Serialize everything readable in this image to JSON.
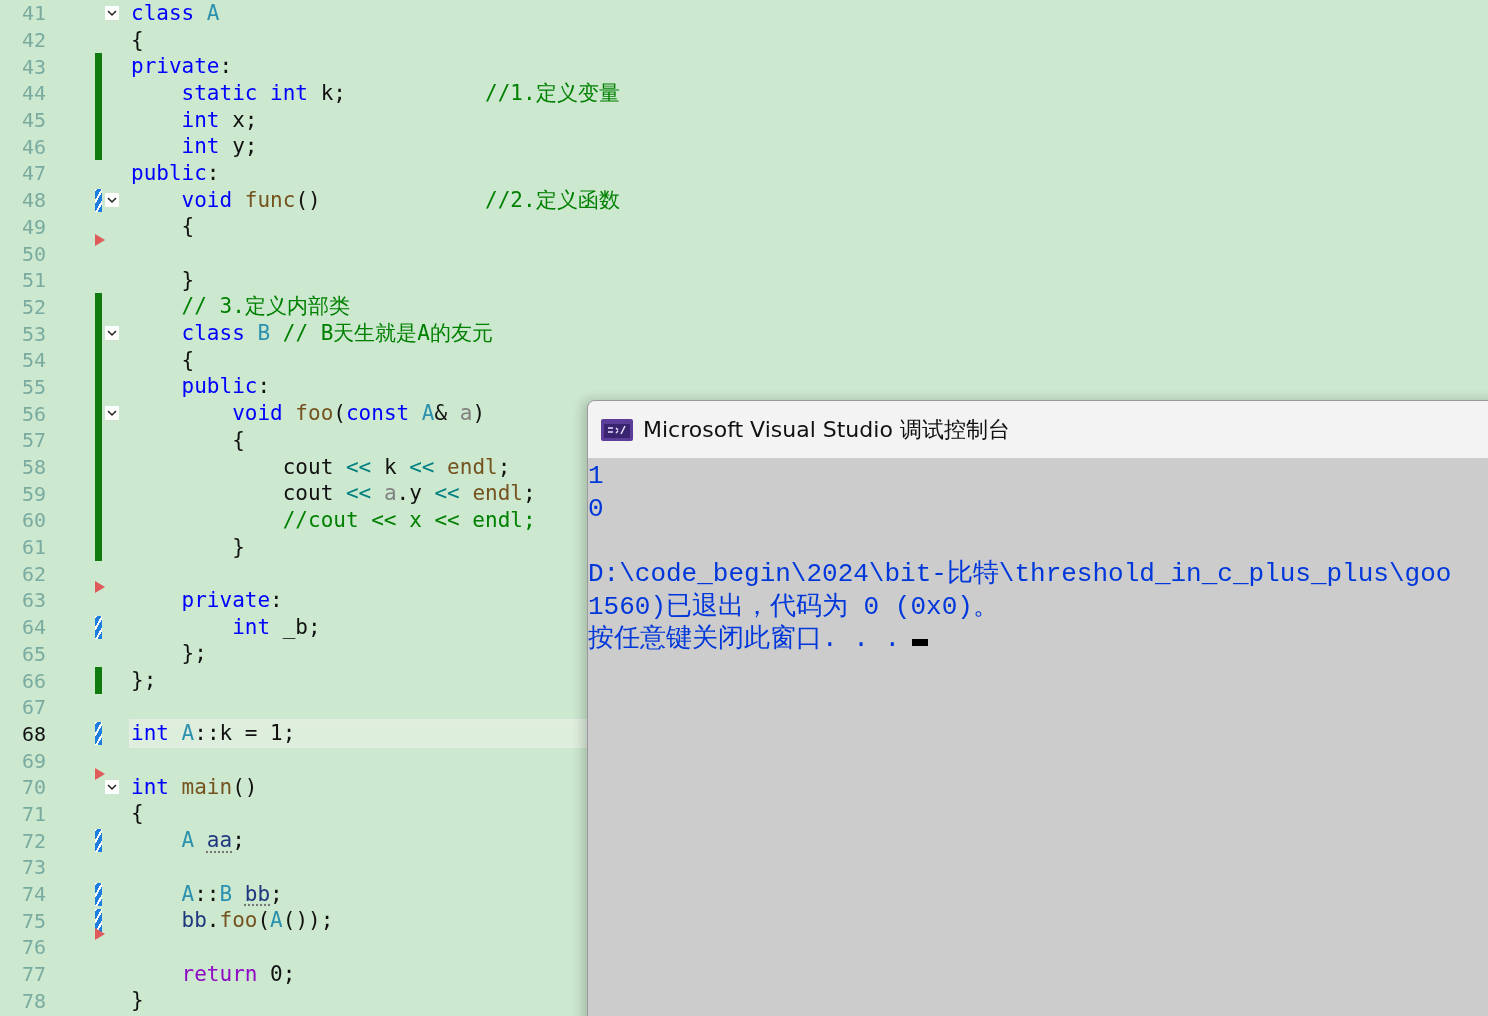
{
  "editor": {
    "lines": [
      {
        "number": "41",
        "fold_toggle": true,
        "tokens": [
          {
            "kind": "keyword",
            "text": "class"
          },
          {
            "kind": "type",
            "text": " A"
          }
        ]
      },
      {
        "number": "42",
        "tokens": [
          {
            "kind": "plain",
            "text": "{"
          }
        ]
      },
      {
        "number": "43",
        "saved": true,
        "tokens": [
          {
            "kind": "keyword",
            "text": "private"
          },
          {
            "kind": "plain",
            "text": ":"
          }
        ]
      },
      {
        "number": "44",
        "saved": true,
        "tokens": [
          {
            "kind": "keyword",
            "text": "    static int"
          },
          {
            "kind": "plain",
            "text": " k;"
          },
          {
            "kind": "comment",
            "text": "           //1.定义变量"
          }
        ]
      },
      {
        "number": "45",
        "saved": true,
        "tokens": [
          {
            "kind": "keyword",
            "text": "    int"
          },
          {
            "kind": "plain",
            "text": " x;"
          }
        ]
      },
      {
        "number": "46",
        "saved": true,
        "tokens": [
          {
            "kind": "keyword",
            "text": "    int"
          },
          {
            "kind": "plain",
            "text": " y;"
          }
        ]
      },
      {
        "number": "47",
        "tokens": [
          {
            "kind": "keyword",
            "text": "public"
          },
          {
            "kind": "plain",
            "text": ":"
          }
        ]
      },
      {
        "number": "48",
        "saved": false,
        "fold_toggle": true,
        "tokens": [
          {
            "kind": "keyword",
            "text": "    void"
          },
          {
            "kind": "function",
            "text": " func"
          },
          {
            "kind": "plain",
            "text": "()"
          },
          {
            "kind": "comment",
            "text": "             //2.定义函数"
          }
        ]
      },
      {
        "number": "49",
        "tokens": [
          {
            "kind": "plain",
            "text": "    {"
          }
        ]
      },
      {
        "number": "50",
        "hint_arrow": true
      },
      {
        "number": "51",
        "tokens": [
          {
            "kind": "plain",
            "text": "    }"
          }
        ]
      },
      {
        "number": "52",
        "saved": true,
        "tokens": [
          {
            "kind": "comment",
            "text": "    // 3.定义内部类"
          }
        ]
      },
      {
        "number": "53",
        "saved": true,
        "fold_toggle": true,
        "tokens": [
          {
            "kind": "keyword",
            "text": "    class"
          },
          {
            "kind": "type",
            "text": " B"
          },
          {
            "kind": "comment",
            "text": " // B天生就是A的友元"
          }
        ]
      },
      {
        "number": "54",
        "saved": true,
        "tokens": [
          {
            "kind": "plain",
            "text": "    {"
          }
        ]
      },
      {
        "number": "55",
        "saved": true,
        "tokens": [
          {
            "kind": "keyword",
            "text": "    public"
          },
          {
            "kind": "plain",
            "text": ":"
          }
        ]
      },
      {
        "number": "56",
        "saved": true,
        "fold_toggle": true,
        "tokens": [
          {
            "kind": "keyword",
            "text": "        void"
          },
          {
            "kind": "function",
            "text": " foo"
          },
          {
            "kind": "plain",
            "text": "("
          },
          {
            "kind": "keyword",
            "text": "const"
          },
          {
            "kind": "type",
            "text": " A"
          },
          {
            "kind": "plain",
            "text": "&"
          },
          {
            "kind": "parameter",
            "text": " a"
          },
          {
            "kind": "plain",
            "text": ")"
          }
        ]
      },
      {
        "number": "57",
        "saved": true,
        "tokens": [
          {
            "kind": "plain",
            "text": "        {"
          }
        ]
      },
      {
        "number": "58",
        "saved": true,
        "tokens": [
          {
            "kind": "plain",
            "text": "            cout "
          },
          {
            "kind": "operator",
            "text": "<<"
          },
          {
            "kind": "plain",
            "text": " k "
          },
          {
            "kind": "operator",
            "text": "<<"
          },
          {
            "kind": "function",
            "text": " endl"
          },
          {
            "kind": "plain",
            "text": ";"
          }
        ]
      },
      {
        "number": "59",
        "saved": true,
        "tokens": [
          {
            "kind": "plain",
            "text": "            cout "
          },
          {
            "kind": "operator",
            "text": "<<"
          },
          {
            "kind": "parameter",
            "text": " a"
          },
          {
            "kind": "plain",
            "text": ".y "
          },
          {
            "kind": "operator",
            "text": "<<"
          },
          {
            "kind": "function",
            "text": " endl"
          },
          {
            "kind": "plain",
            "text": ";"
          }
        ]
      },
      {
        "number": "60",
        "saved": true,
        "tokens": [
          {
            "kind": "comment",
            "text": "            //cout << x << endl;"
          }
        ]
      },
      {
        "number": "61",
        "saved": true,
        "tokens": [
          {
            "kind": "plain",
            "text": "        }"
          }
        ]
      },
      {
        "number": "62"
      },
      {
        "number": "63",
        "hint_arrow": true,
        "tokens": [
          {
            "kind": "keyword",
            "text": "    private"
          },
          {
            "kind": "plain",
            "text": ":"
          }
        ]
      },
      {
        "number": "64",
        "saved": false,
        "tokens": [
          {
            "kind": "keyword",
            "text": "        int"
          },
          {
            "kind": "plain",
            "text": " _b;"
          }
        ]
      },
      {
        "number": "65",
        "tokens": [
          {
            "kind": "plain",
            "text": "    };"
          }
        ]
      },
      {
        "number": "66",
        "saved": true,
        "tokens": [
          {
            "kind": "plain",
            "text": "};"
          }
        ]
      },
      {
        "number": "67"
      },
      {
        "number": "68",
        "saved": false,
        "current": true,
        "tokens": [
          {
            "kind": "keyword",
            "text": "int"
          },
          {
            "kind": "type",
            "text": " A"
          },
          {
            "kind": "plain",
            "text": "::k = 1;"
          }
        ]
      },
      {
        "number": "69"
      },
      {
        "number": "70",
        "hint_arrow": true,
        "fold_toggle": true,
        "tokens": [
          {
            "kind": "keyword",
            "text": "int"
          },
          {
            "kind": "function",
            "text": " main"
          },
          {
            "kind": "plain",
            "text": "()"
          }
        ]
      },
      {
        "number": "71",
        "tokens": [
          {
            "kind": "plain",
            "text": "{"
          }
        ]
      },
      {
        "number": "72",
        "saved": false,
        "tokens": [
          {
            "kind": "type",
            "text": "    A "
          },
          {
            "kind": "declared",
            "text": "aa"
          },
          {
            "kind": "plain",
            "text": ";"
          }
        ]
      },
      {
        "number": "73"
      },
      {
        "number": "74",
        "saved": false,
        "tokens": [
          {
            "kind": "type",
            "text": "    A"
          },
          {
            "kind": "plain",
            "text": "::"
          },
          {
            "kind": "type",
            "text": "B "
          },
          {
            "kind": "declared",
            "text": "bb"
          },
          {
            "kind": "plain",
            "text": ";"
          }
        ]
      },
      {
        "number": "75",
        "saved": false,
        "tokens": [
          {
            "kind": "variable",
            "text": "    bb"
          },
          {
            "kind": "plain",
            "text": "."
          },
          {
            "kind": "function",
            "text": "foo"
          },
          {
            "kind": "plain",
            "text": "("
          },
          {
            "kind": "type",
            "text": "A"
          },
          {
            "kind": "plain",
            "text": "());"
          }
        ]
      },
      {
        "number": "76",
        "hint_arrow": true
      },
      {
        "number": "77",
        "tokens": [
          {
            "kind": "control",
            "text": "    return"
          },
          {
            "kind": "plain",
            "text": " 0;"
          }
        ]
      },
      {
        "number": "78",
        "tokens": [
          {
            "kind": "plain",
            "text": "}"
          }
        ]
      }
    ]
  },
  "console": {
    "title": "Microsoft Visual Studio 调试控制台",
    "lines": [
      {
        "text": "1"
      },
      {
        "text": "0"
      },
      {
        "text": "D:\\code_begin\\2024\\bit-比特\\threshold_in_c_plus_plus\\goo",
        "blank_line_before": true
      },
      {
        "text": "1560)已退出，代码为 0 (0x0)。"
      },
      {
        "text": "按任意键关闭此窗口. . ."
      }
    ]
  }
}
